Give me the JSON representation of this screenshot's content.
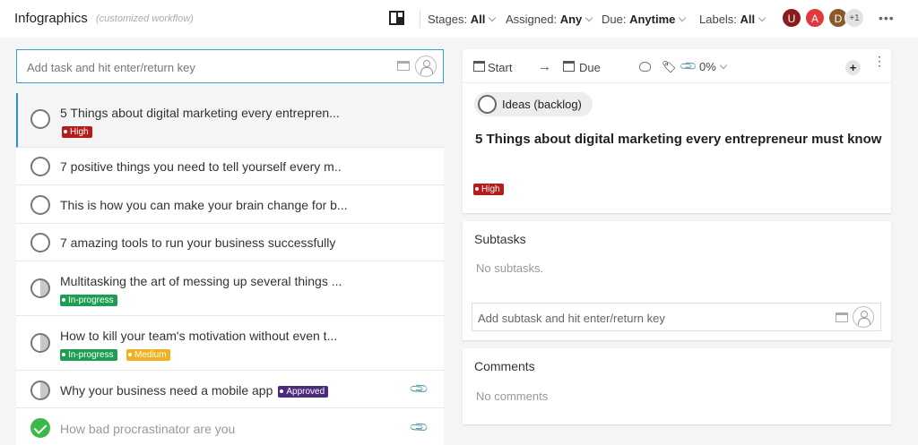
{
  "header": {
    "title": "Infographics",
    "subtitle": "(customized workflow)",
    "filters": [
      {
        "label": "Stages:",
        "value": "All"
      },
      {
        "label": "Assigned:",
        "value": "Any"
      },
      {
        "label": "Due:",
        "value": "Anytime"
      },
      {
        "label": "Labels:",
        "value": "All"
      }
    ],
    "avatars": [
      {
        "initial": "U",
        "color": "#8b1c1c"
      },
      {
        "initial": "A",
        "color": "#e0393e"
      },
      {
        "initial": "D",
        "color": "#8a5a2b"
      },
      {
        "initial": "+1",
        "color": "#e2e2e2"
      }
    ],
    "more_icon": "•••"
  },
  "add_task": {
    "placeholder": "Add task and hit enter/return key"
  },
  "tasks": [
    {
      "title": "5 Things about digital marketing every entrepren...",
      "status": "empty",
      "tags": [
        {
          "text": "High",
          "color": "#b71c1c"
        }
      ]
    },
    {
      "title": "7 positive things you need to tell yourself every m..",
      "status": "empty",
      "tags": []
    },
    {
      "title": "This is how you can make your brain change for b...",
      "status": "empty",
      "tags": []
    },
    {
      "title": "7 amazing tools to run your business successfully",
      "status": "empty",
      "tags": []
    },
    {
      "title": "Multitasking the art of messing up several things ...",
      "status": "half",
      "tags": [
        {
          "text": "In-progress",
          "color": "#1e9e53"
        }
      ]
    },
    {
      "title": "How to kill your team's motivation without even t...",
      "status": "half",
      "tags": [
        {
          "text": "In-progress",
          "color": "#1e9e53"
        },
        {
          "text": "Medium",
          "color": "#f0b020"
        }
      ]
    },
    {
      "title": "Why your business need a mobile app",
      "status": "half",
      "tags": [
        {
          "text": "Approved",
          "color": "#4a2a7a"
        }
      ],
      "attachment": true
    },
    {
      "title": "How bad procrastinator are you",
      "status": "done",
      "tags": [],
      "attachment": true
    }
  ],
  "detail": {
    "toolbar": {
      "start_label": "Start",
      "arrow": "→",
      "due_label": "Due",
      "progress": "0%",
      "tag_icon": "🏷",
      "clip_icon": "📎",
      "add_icon": "+",
      "menu_icon": "⋮"
    },
    "stage": "Ideas (backlog)",
    "title": "5 Things about digital marketing every entrepreneur must know",
    "tag": {
      "text": "High",
      "color": "#b71c1c"
    }
  },
  "subtasks": {
    "heading": "Subtasks",
    "empty_text": "No subtasks.",
    "placeholder": "Add subtask and hit enter/return key"
  },
  "comments": {
    "heading": "Comments",
    "empty_text": "No comments"
  },
  "icons": {
    "attachment": "📎"
  }
}
